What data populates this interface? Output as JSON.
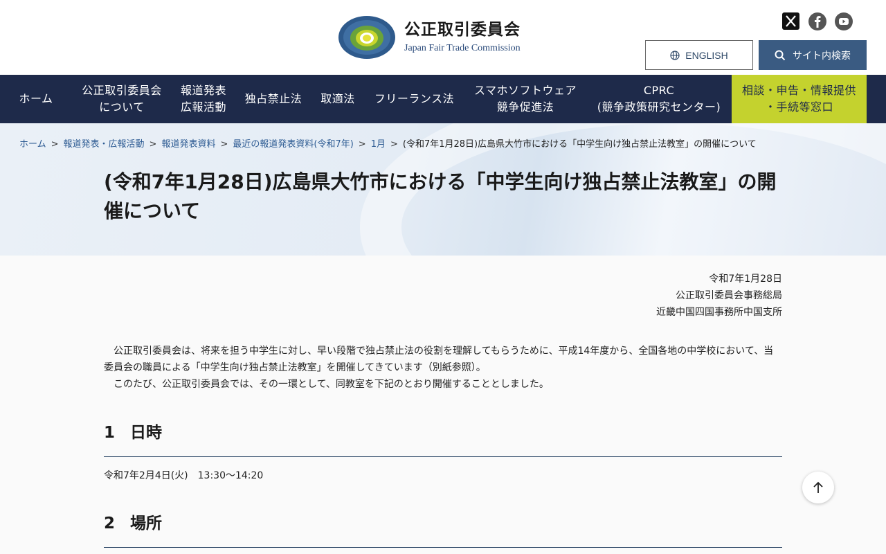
{
  "header": {
    "logo_ja": "公正取引委員会",
    "logo_en": "Japan Fair Trade Commission",
    "english_label": "ENGLISH",
    "search_label": "サイト内検索"
  },
  "nav": [
    {
      "label": "ホーム"
    },
    {
      "label": "公正取引委員会\nについて"
    },
    {
      "label": "報道発表\n広報活動"
    },
    {
      "label": "独占禁止法"
    },
    {
      "label": "取適法"
    },
    {
      "label": "フリーランス法"
    },
    {
      "label": "スマホソフトウェア\n競争促進法"
    },
    {
      "label": "CPRC\n(競争政策研究センター)"
    },
    {
      "label": "相談・申告・情報提供\n・手続等窓口"
    }
  ],
  "breadcrumb": {
    "items": [
      "ホーム",
      "報道発表・広報活動",
      "報道発表資料",
      "最近の報道発表資料(令和7年)",
      "1月"
    ],
    "current": "(令和7年1月28日)広島県大竹市における「中学生向け独占禁止法教室」の開催について",
    "separator": ">"
  },
  "page_title": "(令和7年1月28日)広島県大竹市における「中学生向け独占禁止法教室」の開催について",
  "meta": {
    "date": "令和7年1月28日",
    "org1": "公正取引委員会事務総局",
    "org2": "近畿中国四国事務所中国支所"
  },
  "intro": {
    "p1": "公正取引委員会は、将来を担う中学生に対し、早い段階で独占禁止法の役割を理解してもらうために、平成14年度から、全国各地の中学校において、当委員会の職員による「中学生向け独占禁止法教室」を開催してきています（別紙参照）。",
    "p2": "このたび、公正取引委員会では、その一環として、同教室を下記のとおり開催することとしました。"
  },
  "sections": [
    {
      "num": "1",
      "title": "日時",
      "body": "令和7年2月4日(火)　13:30～14:20"
    },
    {
      "num": "2",
      "title": "場所"
    }
  ],
  "icons": {
    "social": [
      "x-icon",
      "facebook-icon",
      "youtube-icon"
    ],
    "globe": "globe-icon",
    "search": "search-icon",
    "to_top": "arrow-up-icon"
  },
  "colors": {
    "nav_bg": "#1e2a4a",
    "consult_bg": "#c4d22e",
    "search_bg": "#3a5b82",
    "link": "#2d5b93"
  }
}
